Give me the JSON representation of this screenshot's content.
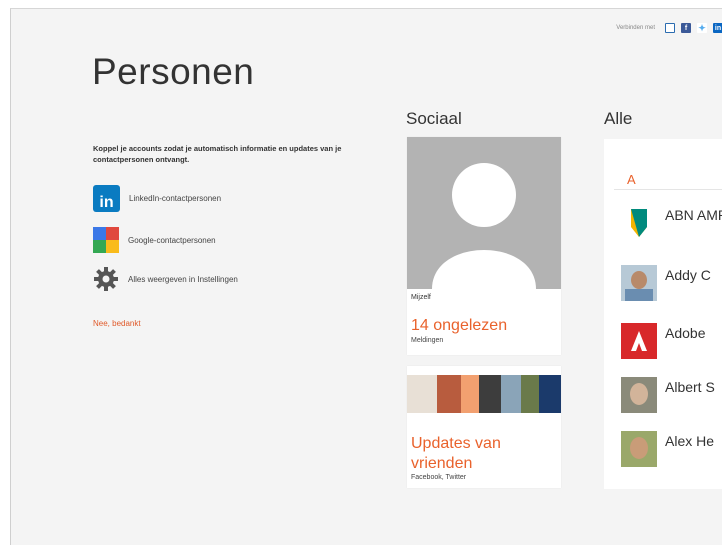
{
  "connect_bar": {
    "label": "Verbinden met",
    "icons": [
      "outlook-icon",
      "facebook-icon",
      "twitter-icon",
      "linkedin-icon"
    ]
  },
  "title": "Personen",
  "intro": "Koppel je accounts zodat je automatisch informatie en updates van je contactpersonen ontvangt.",
  "accounts": [
    {
      "label": "LinkedIn-contactpersonen",
      "icon": "linkedin-icon"
    },
    {
      "label": "Google-contactpersonen",
      "icon": "google-icon"
    },
    {
      "label": "Alles weergeven in Instellingen",
      "icon": "gear-icon"
    }
  ],
  "decline": "Nee, bedankt",
  "social": {
    "heading": "Sociaal",
    "me": {
      "label": "Mijzelf",
      "count": "14 ongelezen",
      "sub": "Meldingen"
    },
    "updates": {
      "title": "Updates van vrienden",
      "sub": "Facebook, Twitter"
    }
  },
  "all": {
    "heading": "Alle",
    "letter": "A",
    "contacts": [
      "ABN AMRO",
      "Addy C",
      "Adobe",
      "Albert S",
      "Alex He"
    ]
  },
  "colors": {
    "accent": "#e9622c",
    "background": "#f4f4f4",
    "linkedin": "#0a7bc1"
  }
}
